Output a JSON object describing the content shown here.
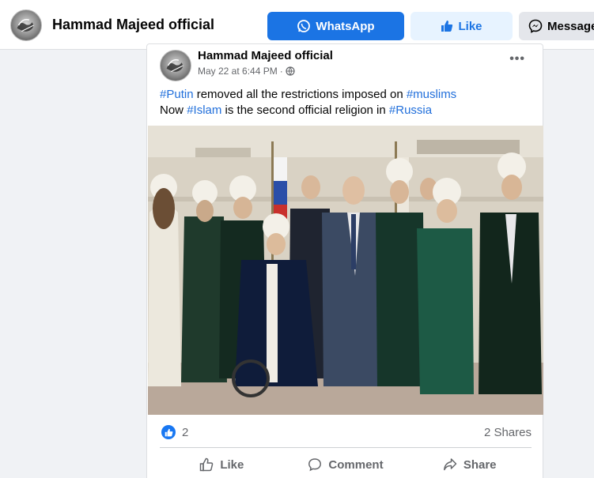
{
  "header": {
    "page_name": "Hammad Majeed official",
    "whatsapp_label": "WhatsApp",
    "like_label": "Like",
    "message_label": "Message"
  },
  "post": {
    "author": "Hammad Majeed official",
    "timestamp": "May 22 at 6:44 PM",
    "meta_sep": "·",
    "audience_icon": "globe-icon",
    "line1": {
      "tag1": "#Putin",
      "text1": " removed all the restrictions imposed on ",
      "tag2": "#muslims"
    },
    "line2": {
      "text1": "Now ",
      "tag1": "#Islam",
      "text2": " is the second official religion in ",
      "tag2": "#Russia"
    },
    "reactions_count": "2",
    "shares": "2 Shares",
    "actions": {
      "like": "Like",
      "comment": "Comment",
      "share": "Share"
    }
  },
  "colors": {
    "brand_blue": "#1b74e4",
    "hashtag": "#216fdb",
    "secondary_text": "#65676b",
    "background": "#f0f2f5"
  }
}
